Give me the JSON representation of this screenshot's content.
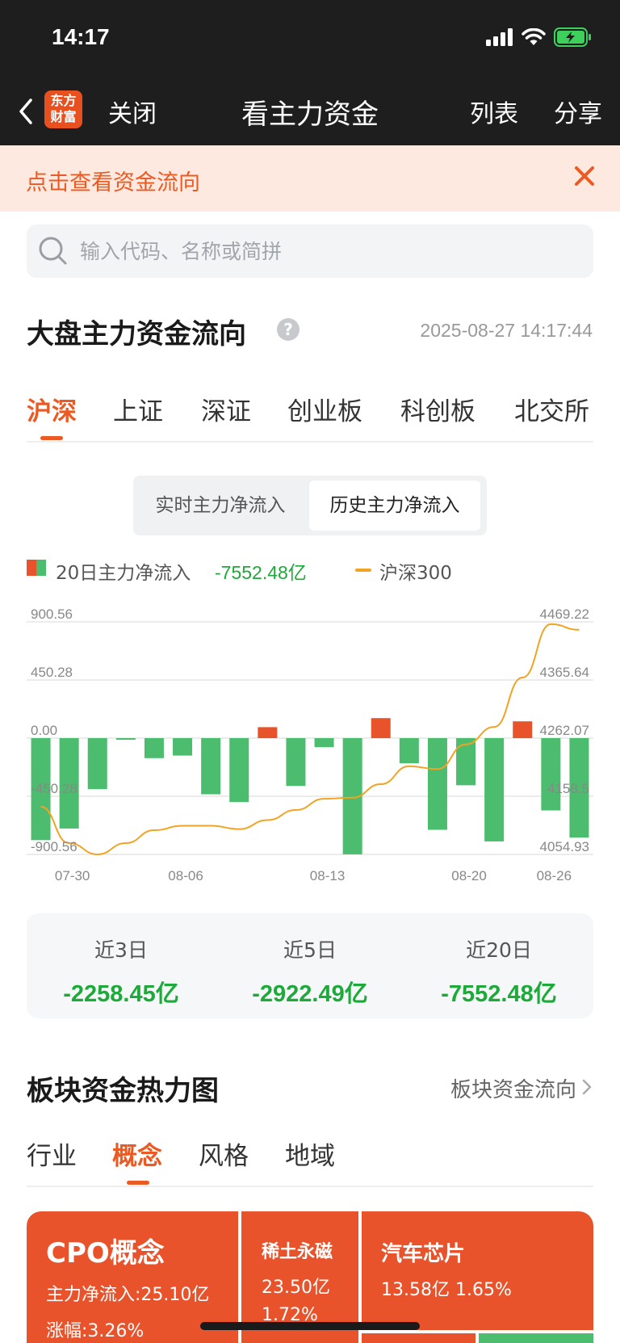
{
  "status_bar": {
    "time": "14:17"
  },
  "nav": {
    "logo_line1": "东方",
    "logo_line2": "财富",
    "close_label": "关闭",
    "title": "看主力资金",
    "list_label": "列表",
    "share_label": "分享"
  },
  "banner": {
    "text": "点击查看资金流向"
  },
  "search": {
    "placeholder": "输入代码、名称或简拼"
  },
  "main_flow": {
    "title": "大盘主力资金流向",
    "timestamp": "2025-08-27 14:17:44",
    "tabs": [
      {
        "label": "沪深",
        "active": true
      },
      {
        "label": "上证"
      },
      {
        "label": "深证"
      },
      {
        "label": "创业板"
      },
      {
        "label": "科创板"
      },
      {
        "label": "北交所"
      }
    ],
    "segments": [
      {
        "label": "实时主力净流入"
      },
      {
        "label": "历史主力净流入",
        "active": true
      }
    ],
    "legend": {
      "series1_label": "20日主力净流入",
      "series1_value": "-7552.48亿",
      "series2_label": "沪深300"
    }
  },
  "chart_data": {
    "type": "bar",
    "left_axis_ticks": [
      "900.56",
      "450.28",
      "0.00",
      "-450.28",
      "-900.56"
    ],
    "right_axis_ticks": [
      "4469.22",
      "4365.64",
      "4262.07",
      "4158.5",
      "4054.93"
    ],
    "x_tick_labels": [
      "07-30",
      "08-06",
      "08-13",
      "08-20",
      "08-26"
    ],
    "ylim_left": [
      -900.56,
      900.56
    ],
    "ylim_right": [
      4054.93,
      4469.22
    ],
    "series": [
      {
        "name": "20日主力净流入",
        "type": "bar",
        "values": [
          -790,
          -700,
          -395,
          -12,
          -155,
          -135,
          -435,
          -495,
          85,
          -370,
          -70,
          -900,
          155,
          -195,
          -710,
          -365,
          -800,
          130,
          -560,
          -770
        ]
      },
      {
        "name": "沪深300",
        "type": "line",
        "values": [
          4140,
          4075,
          4055,
          4075,
          4098,
          4106,
          4106,
          4100,
          4116,
          4134,
          4154,
          4156,
          4180,
          4212,
          4207,
          4251,
          4282,
          4370,
          4465,
          4455
        ]
      }
    ],
    "colors": {
      "positive": "#e8532b",
      "negative": "#4cbc6e",
      "line": "#f3a323"
    }
  },
  "summary": [
    {
      "label": "近3日",
      "value": "-2258.45亿"
    },
    {
      "label": "近5日",
      "value": "-2922.49亿"
    },
    {
      "label": "近20日",
      "value": "-7552.48亿"
    }
  ],
  "heatmap": {
    "title": "板块资金热力图",
    "link_label": "板块资金流向",
    "tabs": [
      {
        "label": "行业"
      },
      {
        "label": "概念",
        "active": true
      },
      {
        "label": "风格"
      },
      {
        "label": "地域"
      }
    ],
    "tiles": [
      {
        "name": "CPO概念",
        "line1": "主力净流入:25.10亿",
        "line2": "涨幅:3.26%"
      },
      {
        "name": "稀土永磁",
        "line1": "23.50亿",
        "line2": "1.72%"
      },
      {
        "name": "汽车芯片",
        "line1": "13.58亿  1.65%"
      }
    ],
    "colors": {
      "tile_red": "#e8532b",
      "tile_green": "#4cbc6e"
    }
  }
}
